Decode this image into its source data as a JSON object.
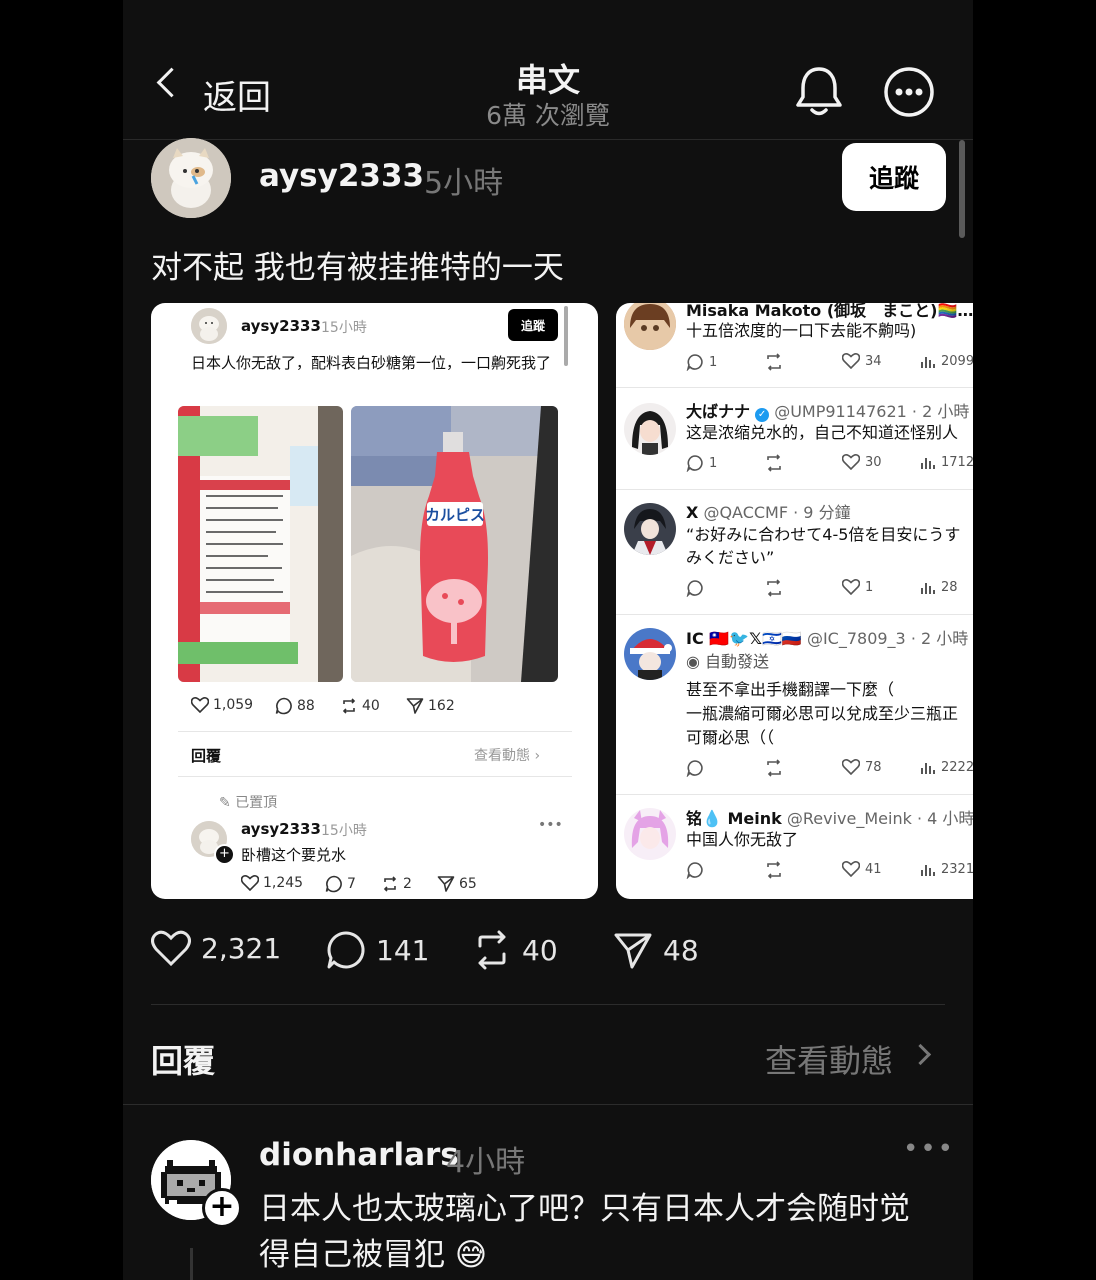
{
  "header": {
    "back_label": "返回",
    "title": "串文",
    "subtitle": "6萬 次瀏覽",
    "bell_icon": "bell-icon",
    "more_icon": "more-icon"
  },
  "post": {
    "username": "aysy2333",
    "time": "5小時",
    "follow_label": "追蹤",
    "text": "对不起 我也有被挂推特的一天",
    "actions": {
      "likes": "2,321",
      "comments": "141",
      "reposts": "40",
      "shares": "48"
    }
  },
  "screenshot1": {
    "username": "aysy2333",
    "time": "15小時",
    "follow_label": "追蹤",
    "text": "日本人你无敌了，配料表白砂糖第一位，一口齁死我了",
    "actions": {
      "likes": "1,059",
      "comments": "88",
      "reposts": "40",
      "shares": "162"
    },
    "reply_label": "回覆",
    "view_label": "查看動態",
    "pinned_label": "已置頂",
    "reply": {
      "username": "aysy2333",
      "time": "15小時",
      "text": "卧槽这个要兑水",
      "actions": {
        "likes": "1,245",
        "comments": "7",
        "reposts": "2",
        "shares": "65"
      }
    }
  },
  "screenshot2": {
    "tweets": [
      {
        "name": "Misaka Makoto (御坂　まこと)🏳️‍🌈…",
        "handle": "",
        "body": [
          "十五倍浓度的一口下去能不齁吗)"
        ],
        "replies": "1",
        "likes": "34",
        "views": "2099"
      },
      {
        "name": "大ばナナ",
        "handle": "@UMP91147621 · 2 小時",
        "body": [
          "这是浓缩兑水的，自己不知道还怪别人"
        ],
        "replies": "1",
        "likes": "30",
        "views": "1712"
      },
      {
        "name": "X",
        "handle": "@QACCMF · 9 分鐘",
        "body": [
          "“お好みに合わせて4-5倍を目安にうす",
          "みください”"
        ],
        "replies": "",
        "likes": "1",
        "views": "28"
      },
      {
        "name": "IC 🇹🇼🐦𝕏🇮🇱🇷🇺",
        "handle": "@IC_7809_3 · 2 小時",
        "auto": "自動發送",
        "body": [
          "甚至不拿出手機翻譯一下麼（",
          "一瓶濃縮可爾必思可以兌成至少三瓶正",
          "可爾必思（（"
        ],
        "replies": "",
        "likes": "78",
        "views": "2222"
      },
      {
        "name": "铭💧 Meink",
        "handle": "@Revive_Meink · 4 小時",
        "body": [
          "中国人你无敌了"
        ],
        "replies": "",
        "likes": "41",
        "views": "2321"
      }
    ]
  },
  "replies_section": {
    "label": "回覆",
    "view_activity": "查看動態"
  },
  "comment": {
    "username": "dionharlars",
    "time": "4小時",
    "text": "日本人也太玻璃心了吧？只有日本人才会随时觉得自己被冒犯 😅"
  }
}
